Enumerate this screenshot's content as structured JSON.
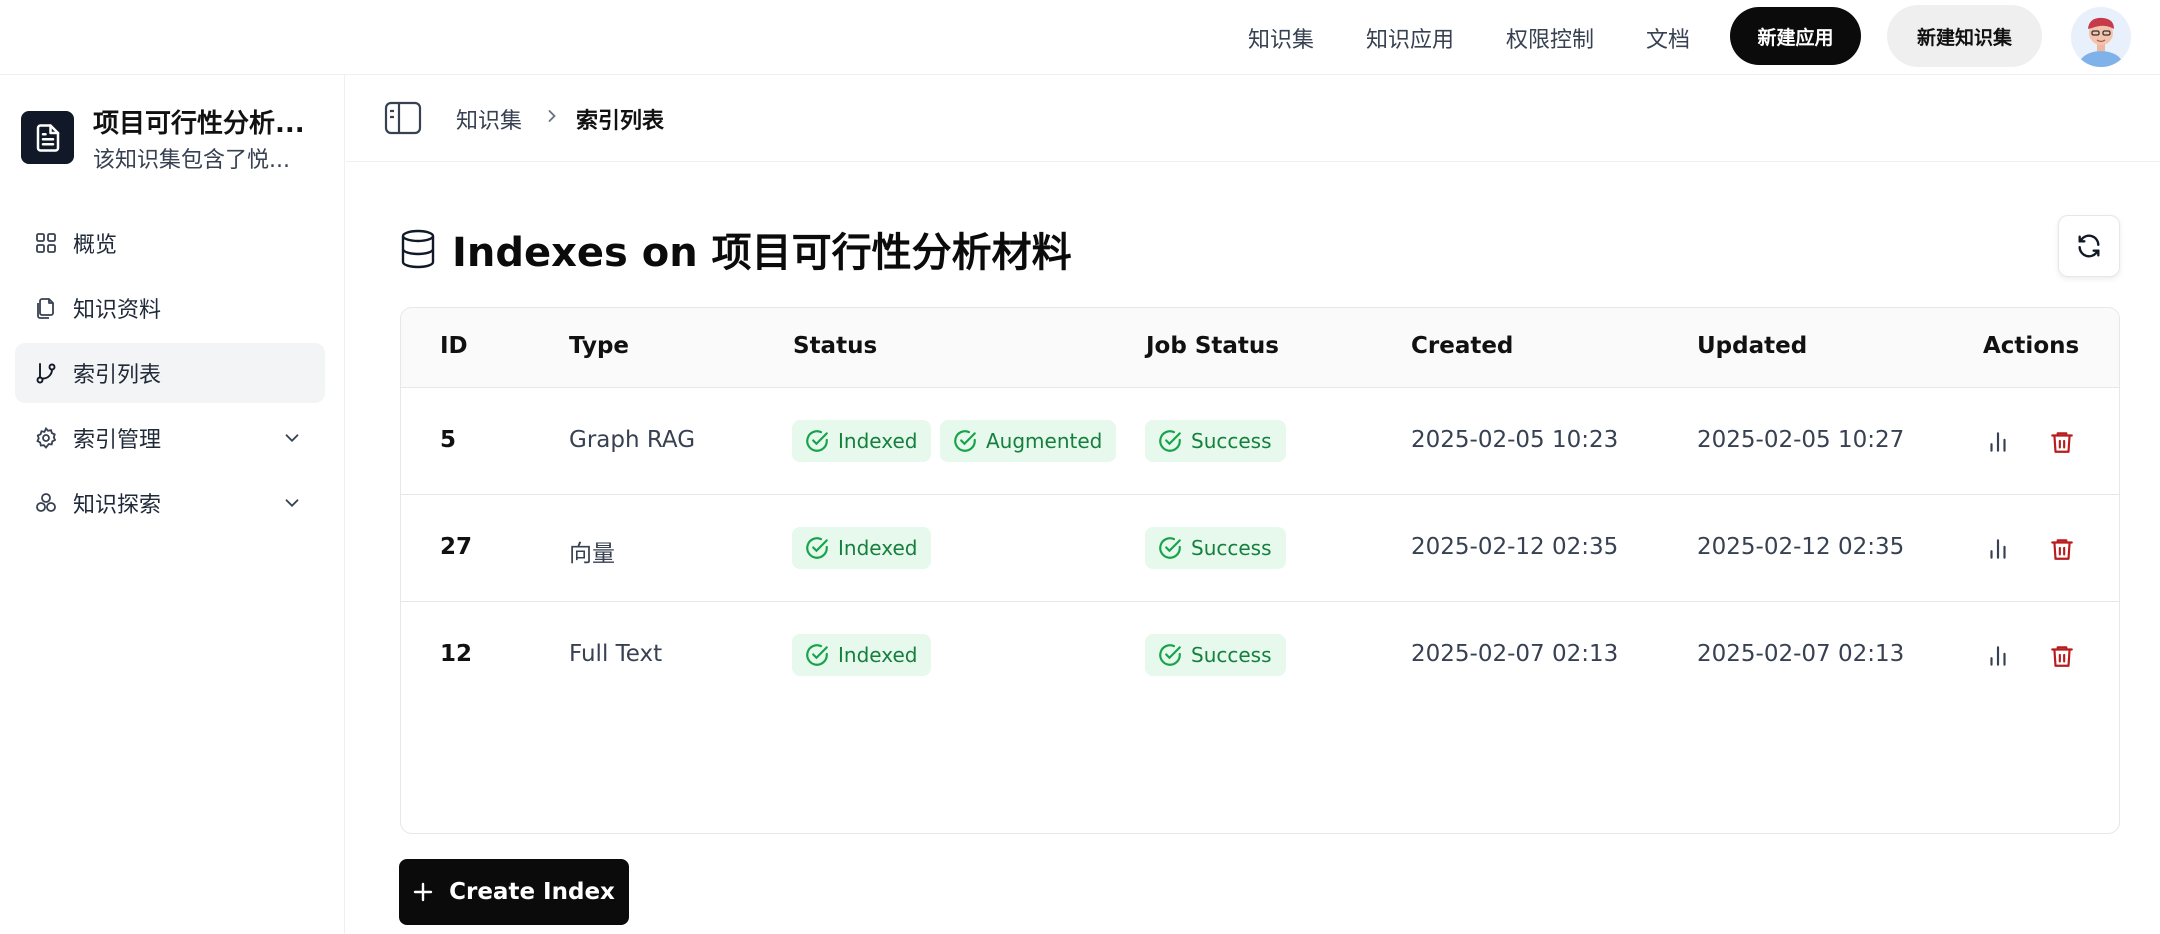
{
  "topnav": {
    "links": [
      "知识集",
      "知识应用",
      "权限控制",
      "文档"
    ],
    "new_app_label": "新建应用",
    "new_kb_label": "新建知识集"
  },
  "sidebar": {
    "kb_title": "项目可行性分析...",
    "kb_desc": "该知识集包含了悦...",
    "items": [
      {
        "label": "概览",
        "icon": "grid-icon",
        "active": false,
        "expandable": false
      },
      {
        "label": "知识资料",
        "icon": "documents-icon",
        "active": false,
        "expandable": false
      },
      {
        "label": "索引列表",
        "icon": "git-branch-icon",
        "active": true,
        "expandable": false
      },
      {
        "label": "索引管理",
        "icon": "gear-icon",
        "active": false,
        "expandable": true
      },
      {
        "label": "知识探索",
        "icon": "molecule-icon",
        "active": false,
        "expandable": true
      }
    ]
  },
  "breadcrumb": {
    "parent": "知识集",
    "current": "索引列表"
  },
  "page": {
    "title": "Indexes on 项目可行性分析材料",
    "create_label": "Create Index"
  },
  "table": {
    "headers": [
      "ID",
      "Type",
      "Status",
      "Job Status",
      "Created",
      "Updated",
      "Actions"
    ],
    "rows": [
      {
        "id": "5",
        "type": "Graph RAG",
        "status": [
          "Indexed",
          "Augmented"
        ],
        "job_status": "Success",
        "created": "2025-02-05 10:23",
        "updated": "2025-02-05 10:27"
      },
      {
        "id": "27",
        "type": "向量",
        "status": [
          "Indexed"
        ],
        "job_status": "Success",
        "created": "2025-02-12 02:35",
        "updated": "2025-02-12 02:35"
      },
      {
        "id": "12",
        "type": "Full Text",
        "status": [
          "Indexed"
        ],
        "job_status": "Success",
        "created": "2025-02-07 02:13",
        "updated": "2025-02-07 02:13"
      }
    ]
  },
  "colors": {
    "primary": "#0b0b0c",
    "badge_bg": "#e7f8ec",
    "badge_text": "#15803d",
    "delete": "#b91c1c"
  }
}
